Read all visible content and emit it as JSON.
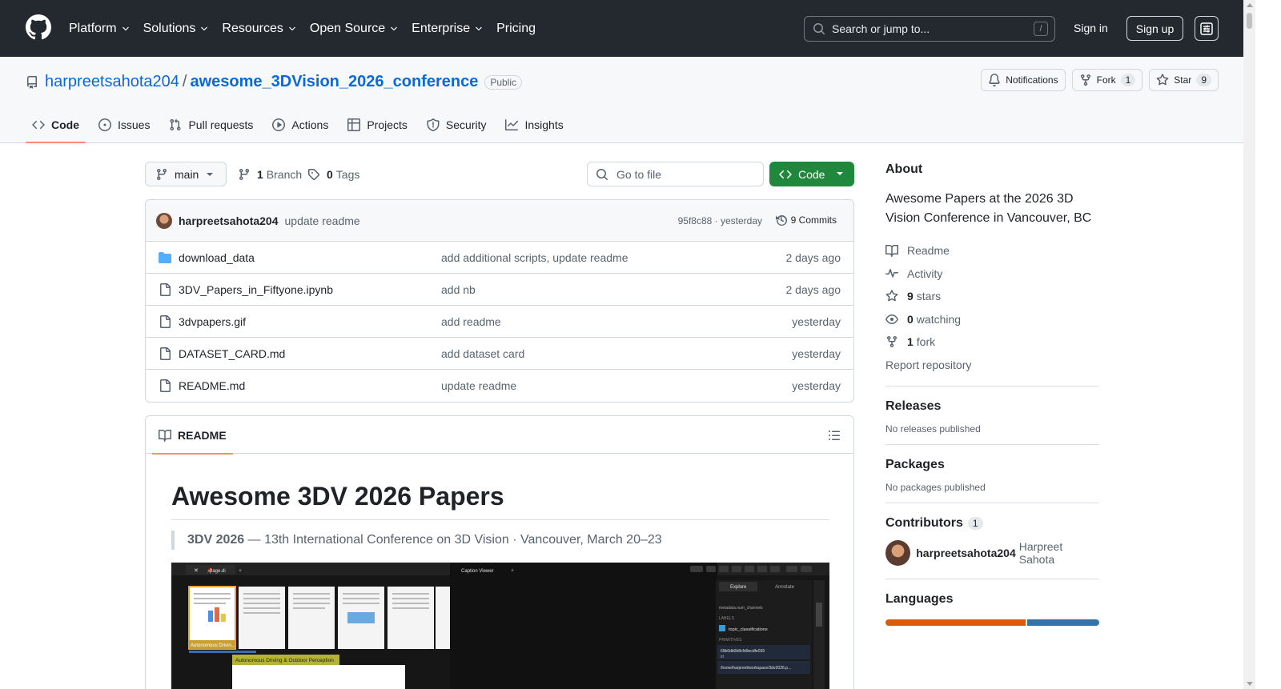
{
  "header": {
    "nav": [
      {
        "label": "Platform",
        "has_menu": true
      },
      {
        "label": "Solutions",
        "has_menu": true
      },
      {
        "label": "Resources",
        "has_menu": true
      },
      {
        "label": "Open Source",
        "has_menu": true
      },
      {
        "label": "Enterprise",
        "has_menu": true
      },
      {
        "label": "Pricing",
        "has_menu": false
      }
    ],
    "search_placeholder": "Search or jump to...",
    "search_shortcut": "/",
    "sign_in": "Sign in",
    "sign_up": "Sign up"
  },
  "repo": {
    "owner": "harpreetsahota204",
    "separator": "/",
    "name": "awesome_3DVision_2026_conference",
    "visibility": "Public",
    "notifications_label": "Notifications",
    "fork_label": "Fork",
    "fork_count": "1",
    "star_label": "Star",
    "star_count": "9",
    "tabs": [
      {
        "label": "Code",
        "icon": "code-icon",
        "active": true
      },
      {
        "label": "Issues",
        "icon": "issue-icon",
        "active": false
      },
      {
        "label": "Pull requests",
        "icon": "pull-request-icon",
        "active": false
      },
      {
        "label": "Actions",
        "icon": "play-icon",
        "active": false
      },
      {
        "label": "Projects",
        "icon": "table-icon",
        "active": false
      },
      {
        "label": "Security",
        "icon": "shield-icon",
        "active": false
      },
      {
        "label": "Insights",
        "icon": "graph-icon",
        "active": false
      }
    ]
  },
  "toolbar": {
    "branch": "main",
    "branch_count": "1",
    "branch_label": "Branch",
    "tag_count": "0",
    "tag_label": "Tags",
    "goto_placeholder": "Go to file",
    "code_label": "Code"
  },
  "commit": {
    "author": "harpreetsahota204",
    "message": "update readme",
    "meta": "95f8c88 · yesterday",
    "commits_label": "9 Commits"
  },
  "files": [
    {
      "type": "folder",
      "name": "download_data",
      "message": "add additional scripts, update readme",
      "date": "2 days ago"
    },
    {
      "type": "file",
      "name": "3DV_Papers_in_Fiftyone.ipynb",
      "message": "add nb",
      "date": "2 days ago"
    },
    {
      "type": "file",
      "name": "3dvpapers.gif",
      "message": "add readme",
      "date": "yesterday"
    },
    {
      "type": "file",
      "name": "DATASET_CARD.md",
      "message": "add dataset card",
      "date": "yesterday"
    },
    {
      "type": "file",
      "name": "README.md",
      "message": "update readme",
      "date": "yesterday"
    }
  ],
  "readme": {
    "tab_label": "README",
    "title": "Awesome 3DV 2026 Papers",
    "quote_bold": "3DV 2026",
    "quote_rest": " — 13th International Conference on 3D Vision · Vancouver, March 20–23",
    "image_text": {
      "tab_title": "page.di",
      "caption_viewer": "Caption Viewer",
      "tag_small": "Autonomous Drivin...",
      "tag_large": "Autonomous Driving & Outdoor Perception",
      "explore": "Explore",
      "annotate": "Annotate",
      "field_metadata": "metadata.num_channels",
      "labels_section": "LABELS",
      "label_topic": "topic_classifications",
      "primitives_section": "PRIMITIVES",
      "primitive_id": "69b0db0b8cfd9ecdfe039",
      "primitive_id_label": "id",
      "primitive_path": "/home/harpreet/workspace/3dv2026.p..."
    }
  },
  "sidebar": {
    "about_title": "About",
    "description": "Awesome Papers at the 2026 3D Vision Conference in Vancouver, BC",
    "readme_link": "Readme",
    "activity_link": "Activity",
    "stars_count": "9",
    "stars_label": "stars",
    "watching_count": "0",
    "watching_label": "watching",
    "fork_count": "1",
    "fork_label": "fork",
    "report": "Report repository",
    "releases_title": "Releases",
    "releases_empty": "No releases published",
    "packages_title": "Packages",
    "packages_empty": "No packages published",
    "contributors_title": "Contributors",
    "contributors_count": "1",
    "contributor_login": "harpreetsahota204",
    "contributor_name": "Harpreet Sahota",
    "languages_title": "Languages",
    "languages": [
      {
        "share": 0.66,
        "color": "#DA5B0B"
      },
      {
        "share": 0.34,
        "color": "#3572A5"
      }
    ]
  }
}
